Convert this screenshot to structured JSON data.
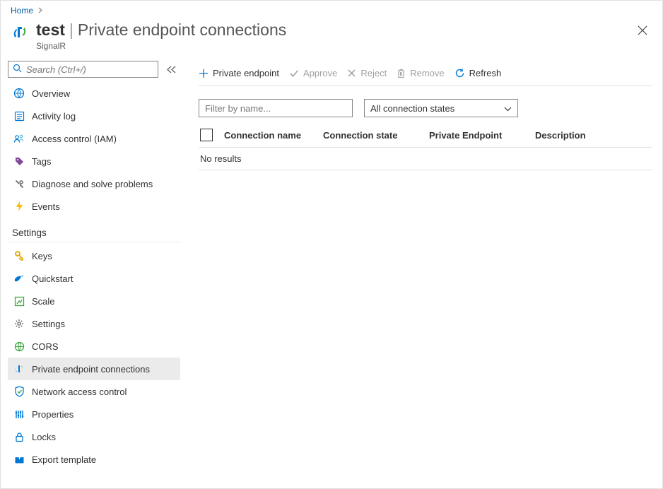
{
  "breadcrumb": {
    "home": "Home"
  },
  "header": {
    "resource_name": "test",
    "page_title": "Private endpoint connections",
    "resource_type": "SignalR"
  },
  "sidebar": {
    "search_placeholder": "Search (Ctrl+/)",
    "items_top": [
      {
        "icon": "overview",
        "label": "Overview",
        "key": "overview"
      },
      {
        "icon": "activity",
        "label": "Activity log",
        "key": "activity-log"
      },
      {
        "icon": "iam",
        "label": "Access control (IAM)",
        "key": "access-control"
      },
      {
        "icon": "tags",
        "label": "Tags",
        "key": "tags"
      },
      {
        "icon": "diagnose",
        "label": "Diagnose and solve problems",
        "key": "diagnose"
      },
      {
        "icon": "events",
        "label": "Events",
        "key": "events"
      }
    ],
    "section_label": "Settings",
    "items_settings": [
      {
        "icon": "keys",
        "label": "Keys",
        "key": "keys"
      },
      {
        "icon": "quickstart",
        "label": "Quickstart",
        "key": "quickstart"
      },
      {
        "icon": "scale",
        "label": "Scale",
        "key": "scale"
      },
      {
        "icon": "settings",
        "label": "Settings",
        "key": "settings"
      },
      {
        "icon": "cors",
        "label": "CORS",
        "key": "cors"
      },
      {
        "icon": "pe",
        "label": "Private endpoint connections",
        "key": "private-endpoint",
        "selected": true
      },
      {
        "icon": "network",
        "label": "Network access control",
        "key": "network-access"
      },
      {
        "icon": "properties",
        "label": "Properties",
        "key": "properties"
      },
      {
        "icon": "locks",
        "label": "Locks",
        "key": "locks"
      },
      {
        "icon": "export",
        "label": "Export template",
        "key": "export-template"
      }
    ]
  },
  "toolbar": {
    "add": "Private endpoint",
    "approve": "Approve",
    "reject": "Reject",
    "remove": "Remove",
    "refresh": "Refresh"
  },
  "filter": {
    "placeholder": "Filter by name...",
    "dropdown": "All connection states"
  },
  "table": {
    "columns": {
      "connection_name": "Connection name",
      "connection_state": "Connection state",
      "private_endpoint": "Private Endpoint",
      "description": "Description"
    },
    "empty": "No results"
  }
}
